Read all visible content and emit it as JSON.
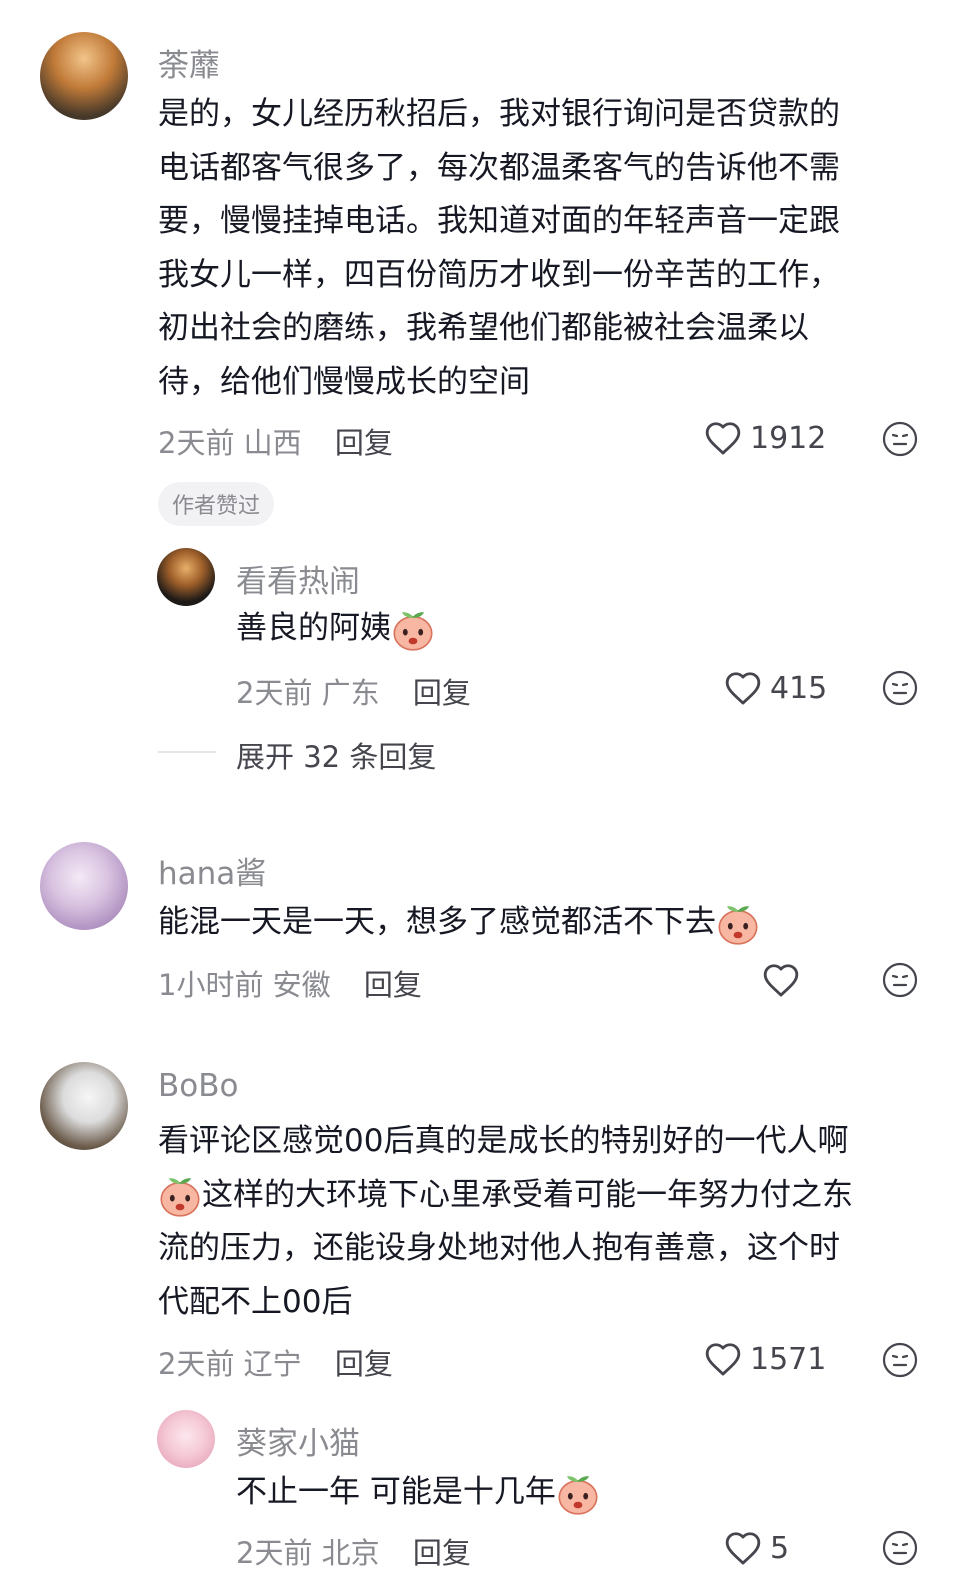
{
  "comments": [
    {
      "author": "荼蘼",
      "lines": [
        "是的，女儿经历秋招后，我对银行询问是否贷款的",
        "电话都客气很多了，每次都温柔客气的告诉他不需",
        "要，慢慢挂掉电话。我知道对面的年轻声音一定跟",
        "我女儿一样，四百份简历才收到一份辛苦的工作，",
        "初出社会的磨练，我希望他们都能被社会温柔以",
        "待，给他们慢慢成长的空间"
      ],
      "time": "2天前",
      "location": "山西",
      "reply_label": "回复",
      "likes": "1912",
      "badge": "作者赞过",
      "replies": [
        {
          "author": "看看热闹",
          "text": "善良的阿姨",
          "time": "2天前",
          "location": "广东",
          "reply_label": "回复",
          "likes": "415"
        }
      ],
      "expand_label": "展开 32 条回复"
    },
    {
      "author": "hana酱",
      "text": "能混一天是一天，想多了感觉都活不下去",
      "time": "1小时前",
      "location": "安徽",
      "reply_label": "回复",
      "likes": ""
    },
    {
      "author": "BoBo",
      "lines": [
        "看评论区感觉00后真的是成长的特别好的一代人啊",
        "这样的大环境下心里承受着可能一年努力付之东",
        "流的压力，还能设身处地对他人抱有善意，这个时",
        "代配不上00后"
      ],
      "time": "2天前",
      "location": "辽宁",
      "reply_label": "回复",
      "likes": "1571",
      "replies": [
        {
          "author": "葵家小猫",
          "text": "不止一年 可能是十几年",
          "time": "2天前",
          "location": "北京",
          "reply_label": "回复",
          "likes": "5"
        }
      ]
    }
  ],
  "icons": {
    "like": "heart-outline-icon",
    "more": "neutral-face-icon"
  },
  "colors": {
    "text_primary": "#161823",
    "text_secondary": "#8a8b91",
    "badge_bg": "#f2f2f4"
  }
}
